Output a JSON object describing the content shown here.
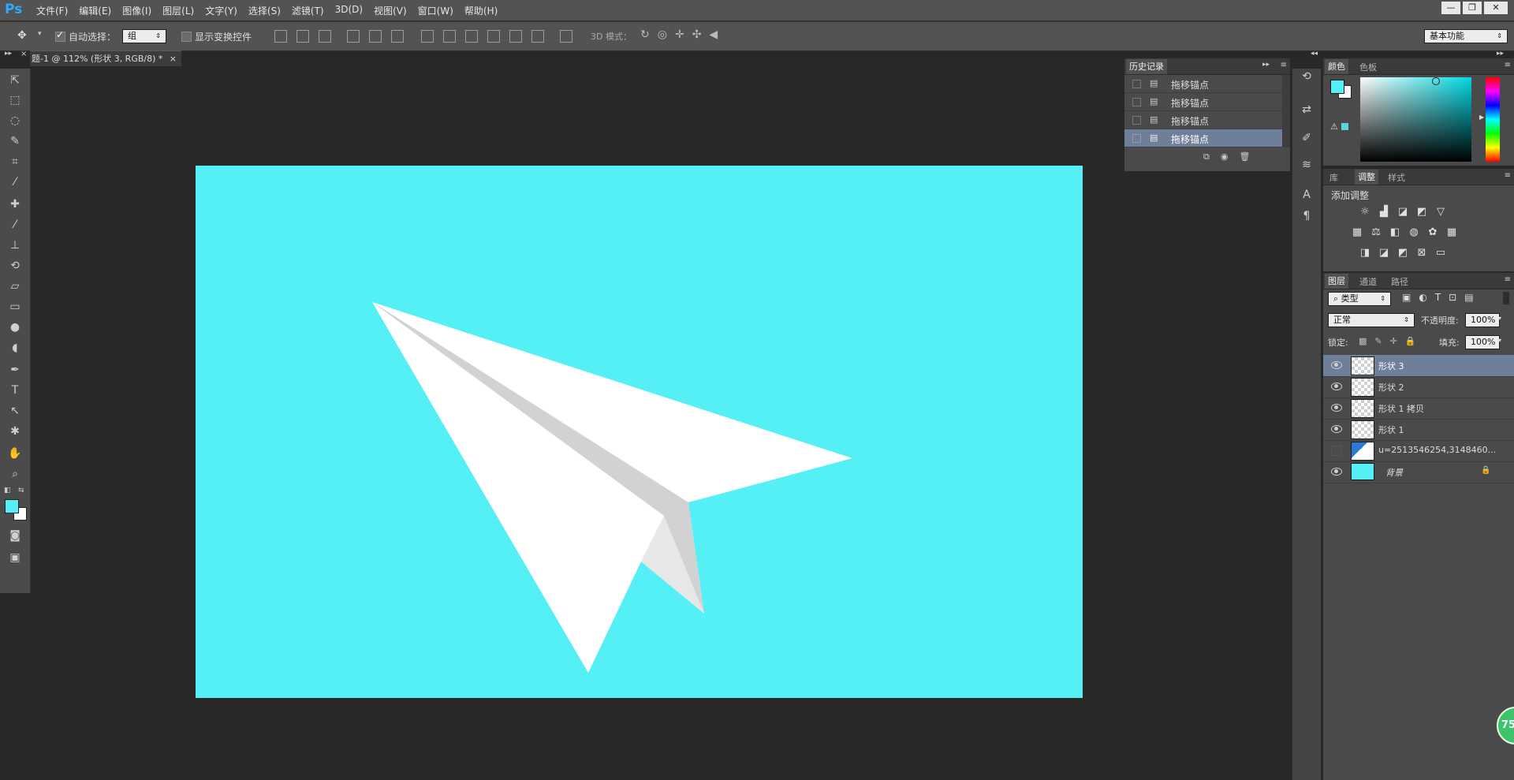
{
  "app": {
    "logo": "Ps"
  },
  "menu": [
    "文件(F)",
    "编辑(E)",
    "图像(I)",
    "图层(L)",
    "文字(Y)",
    "选择(S)",
    "滤镜(T)",
    "3D(D)",
    "视图(V)",
    "窗口(W)",
    "帮助(H)"
  ],
  "window_controls": {
    "minimize": "—",
    "restore": "❐",
    "close": "✕"
  },
  "options": {
    "auto_select_label": "自动选择：",
    "auto_select_value": "组",
    "transform_label": "显示变换控件",
    "mode_3d_label": "3D 模式：",
    "workspace": "基本功能"
  },
  "document_tab": {
    "title": "题-1 @ 112% (形状 3, RGB/8) *",
    "close": "×"
  },
  "history": {
    "tab": "历史记录",
    "items": [
      "拖移锚点",
      "拖移锚点",
      "拖移锚点",
      "拖移锚点"
    ],
    "selected_index": 3
  },
  "color_panel": {
    "tabs": [
      "颜色",
      "色板"
    ],
    "foreground": "#55f0f6",
    "background": "#ffffff"
  },
  "adjust_panel": {
    "tabs": [
      "库",
      "调整",
      "样式"
    ],
    "title": "添加调整"
  },
  "layers_panel": {
    "tabs": [
      "图层",
      "通道",
      "路径"
    ],
    "filter": "类型",
    "blend_mode": "正常",
    "opacity_label": "不透明度:",
    "opacity_value": "100%",
    "lock_label": "锁定:",
    "fill_label": "填充:",
    "fill_value": "100%",
    "layers": [
      {
        "name": "形状 3",
        "selected": true,
        "visible": true
      },
      {
        "name": "形状 2",
        "selected": false,
        "visible": true
      },
      {
        "name": "形状 1 拷贝",
        "selected": false,
        "visible": true
      },
      {
        "name": "形状 1",
        "selected": false,
        "visible": true
      },
      {
        "name": "u=2513546254,3148460...",
        "selected": false,
        "visible": false
      },
      {
        "name": "背景",
        "selected": false,
        "visible": true
      }
    ]
  },
  "badge": {
    "value": "75"
  },
  "colors": {
    "canvas": "#55f0f6",
    "selection": "#6e7f9a",
    "ui_dark": "#282828"
  }
}
